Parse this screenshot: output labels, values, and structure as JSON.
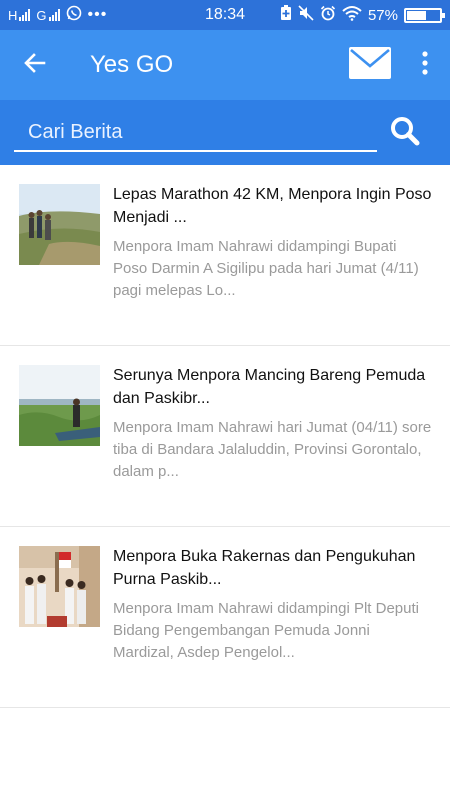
{
  "status_bar": {
    "carrier1": "H",
    "carrier2": "G",
    "time": "18:34",
    "battery_percent": "57%",
    "battery_level": 0.57
  },
  "app_bar": {
    "title": "Yes GO",
    "icons": [
      "back-arrow-icon",
      "mail-icon",
      "more-vert-icon"
    ]
  },
  "search": {
    "placeholder": "Cari Berita",
    "value": ""
  },
  "news": [
    {
      "title": "Lepas Marathon 42 KM, Menpora Ingin Poso Menjadi ...",
      "excerpt": "Menpora Imam Nahrawi didampingi Bupati Poso Darmin A Sigilipu pada hari Jumat (4/11) pagi melepas Lo..."
    },
    {
      "title": "Serunya Menpora Mancing Bareng Pemuda dan Paskibr...",
      "excerpt": "Menpora Imam Nahrawi hari Jumat (04/11) sore tiba di Bandara Jalaluddin, Provinsi Gorontalo, dalam p..."
    },
    {
      "title": "Menpora Buka Rakernas dan Pengukuhan Purna Paskib...",
      "excerpt": "Menpora Imam Nahrawi didampingi Plt Deputi Bidang Pengembangan Pemuda Jonni Mardizal, Asdep Pengelol..."
    }
  ],
  "colors": {
    "status_bar": "#2d72d9",
    "app_bar": "#3d91f0",
    "search_bar": "#2f7fe6"
  }
}
